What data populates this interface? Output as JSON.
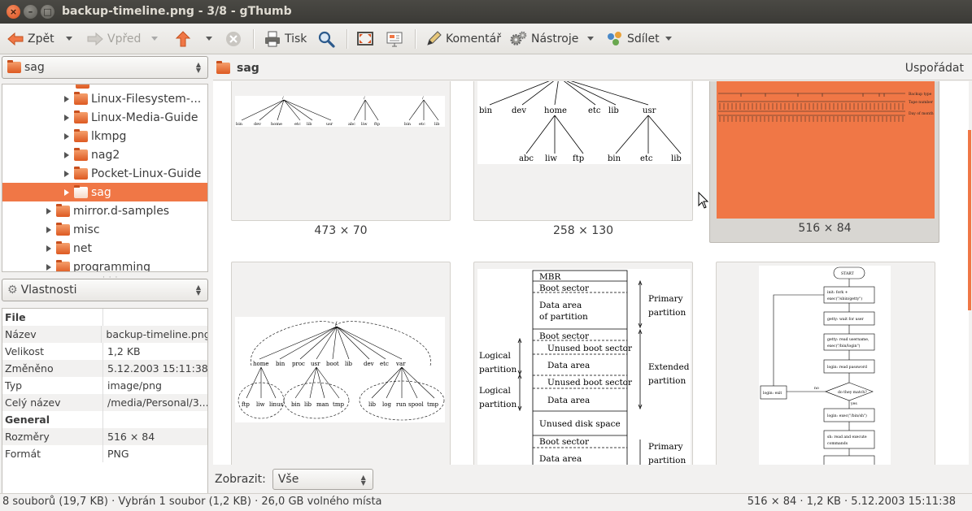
{
  "window": {
    "title": "backup-timeline.png - 3/8 - gThumb"
  },
  "toolbar": {
    "back_label": "Zpět",
    "forward_label": "Vpřed",
    "print_label": "Tisk",
    "comment_label": "Komentář",
    "tools_label": "Nástroje",
    "share_label": "Sdílet"
  },
  "sidebar": {
    "location": "sag",
    "tree": [
      {
        "label": "Linux-Filesystem-...",
        "indent": 2,
        "selected": false
      },
      {
        "label": "Linux-Media-Guide",
        "indent": 2,
        "selected": false
      },
      {
        "label": "lkmpg",
        "indent": 2,
        "selected": false
      },
      {
        "label": "nag2",
        "indent": 2,
        "selected": false
      },
      {
        "label": "Pocket-Linux-Guide",
        "indent": 2,
        "selected": false
      },
      {
        "label": "sag",
        "indent": 2,
        "selected": true
      },
      {
        "label": "mirror.d-samples",
        "indent": 1,
        "selected": false
      },
      {
        "label": "misc",
        "indent": 1,
        "selected": false
      },
      {
        "label": "net",
        "indent": 1,
        "selected": false
      },
      {
        "label": "programming",
        "indent": 1,
        "selected": false
      }
    ],
    "properties_selector": "Vlastnosti",
    "properties": [
      {
        "key": "File",
        "value": "",
        "header": true
      },
      {
        "key": "Název",
        "value": "backup-timeline.png"
      },
      {
        "key": "Velikost",
        "value": "1,2 KB"
      },
      {
        "key": "Změněno",
        "value": "5.12.2003 15:11:38"
      },
      {
        "key": "Typ",
        "value": "image/png"
      },
      {
        "key": "Celý název",
        "value": "/media/Personal/3..."
      },
      {
        "key": "General",
        "value": "",
        "header": true
      },
      {
        "key": "Rozměry",
        "value": "516 × 84"
      },
      {
        "key": "Formát",
        "value": "PNG"
      }
    ]
  },
  "browser": {
    "folder": "sag",
    "sort_label": "Uspořádat",
    "thumbnails": [
      {
        "caption": "473 × 70",
        "selected": false
      },
      {
        "caption": "258 × 130",
        "selected": false
      },
      {
        "caption": "516 × 84",
        "selected": true
      },
      {
        "caption": "",
        "selected": false
      },
      {
        "caption": "",
        "selected": false
      },
      {
        "caption": "",
        "selected": false
      }
    ],
    "show_label": "Zobrazit:",
    "filter_value": "Vše"
  },
  "fs_tree": {
    "root": "/",
    "dirs": [
      "bin",
      "dev",
      "home",
      "etc",
      "lib",
      "usr"
    ],
    "home_dirs": [
      "abc",
      "liw",
      "ftp"
    ],
    "usr_dirs": [
      "bin",
      "etc",
      "lib"
    ]
  },
  "partitions": {
    "rows": [
      "MBR",
      "Boot sector",
      "Data area",
      "of partition",
      "Boot sector",
      "Unused boot sector",
      "Data area",
      "Unused boot sector",
      "Data area",
      "Unused disk space",
      "Boot sector",
      "Data area"
    ],
    "left_labels": [
      "Logical",
      "partition",
      "Logical",
      "partition"
    ],
    "right_labels": [
      "Primary",
      "partition",
      "Extended",
      "partition",
      "Primary",
      "partition"
    ]
  },
  "flowchart": {
    "nodes": [
      "START",
      "init: fork +",
      "exec(\"/sbin/getty\")",
      "getty: wait for user",
      "getty: read username,",
      "exec(\"/bin/login\")",
      "login: read password",
      "do they match?",
      "login: exec(\"/bin/sh\")",
      "sh: read and execute",
      "commands",
      "login: exit"
    ],
    "edge_labels": [
      "no",
      "yes"
    ]
  },
  "timeline": {
    "legend": [
      "Backup type",
      "Tape number",
      "Day of month"
    ]
  },
  "fs_tree2": {
    "root": "/",
    "dirs": [
      "home",
      "bin",
      "proc",
      "usr",
      "boot",
      "lib",
      "dev",
      "etc",
      "var"
    ],
    "home_dirs": [
      "ftp",
      "liw",
      "linus"
    ],
    "usr_dirs": [
      "bin",
      "lib",
      "man",
      "tmp"
    ],
    "var_dirs": [
      "lib",
      "log",
      "run",
      "spool",
      "tmp"
    ]
  },
  "statusbar": {
    "left": "8 souborů (19,7 KB) · Vybrán 1 soubor (1,2 KB) · 26,0 GB volného místa",
    "right": "516 × 84 · 1,2 KB · 5.12.2003 15:11:38"
  },
  "colors": {
    "accent": "#f07746",
    "titlebar": "#3c3b37"
  }
}
